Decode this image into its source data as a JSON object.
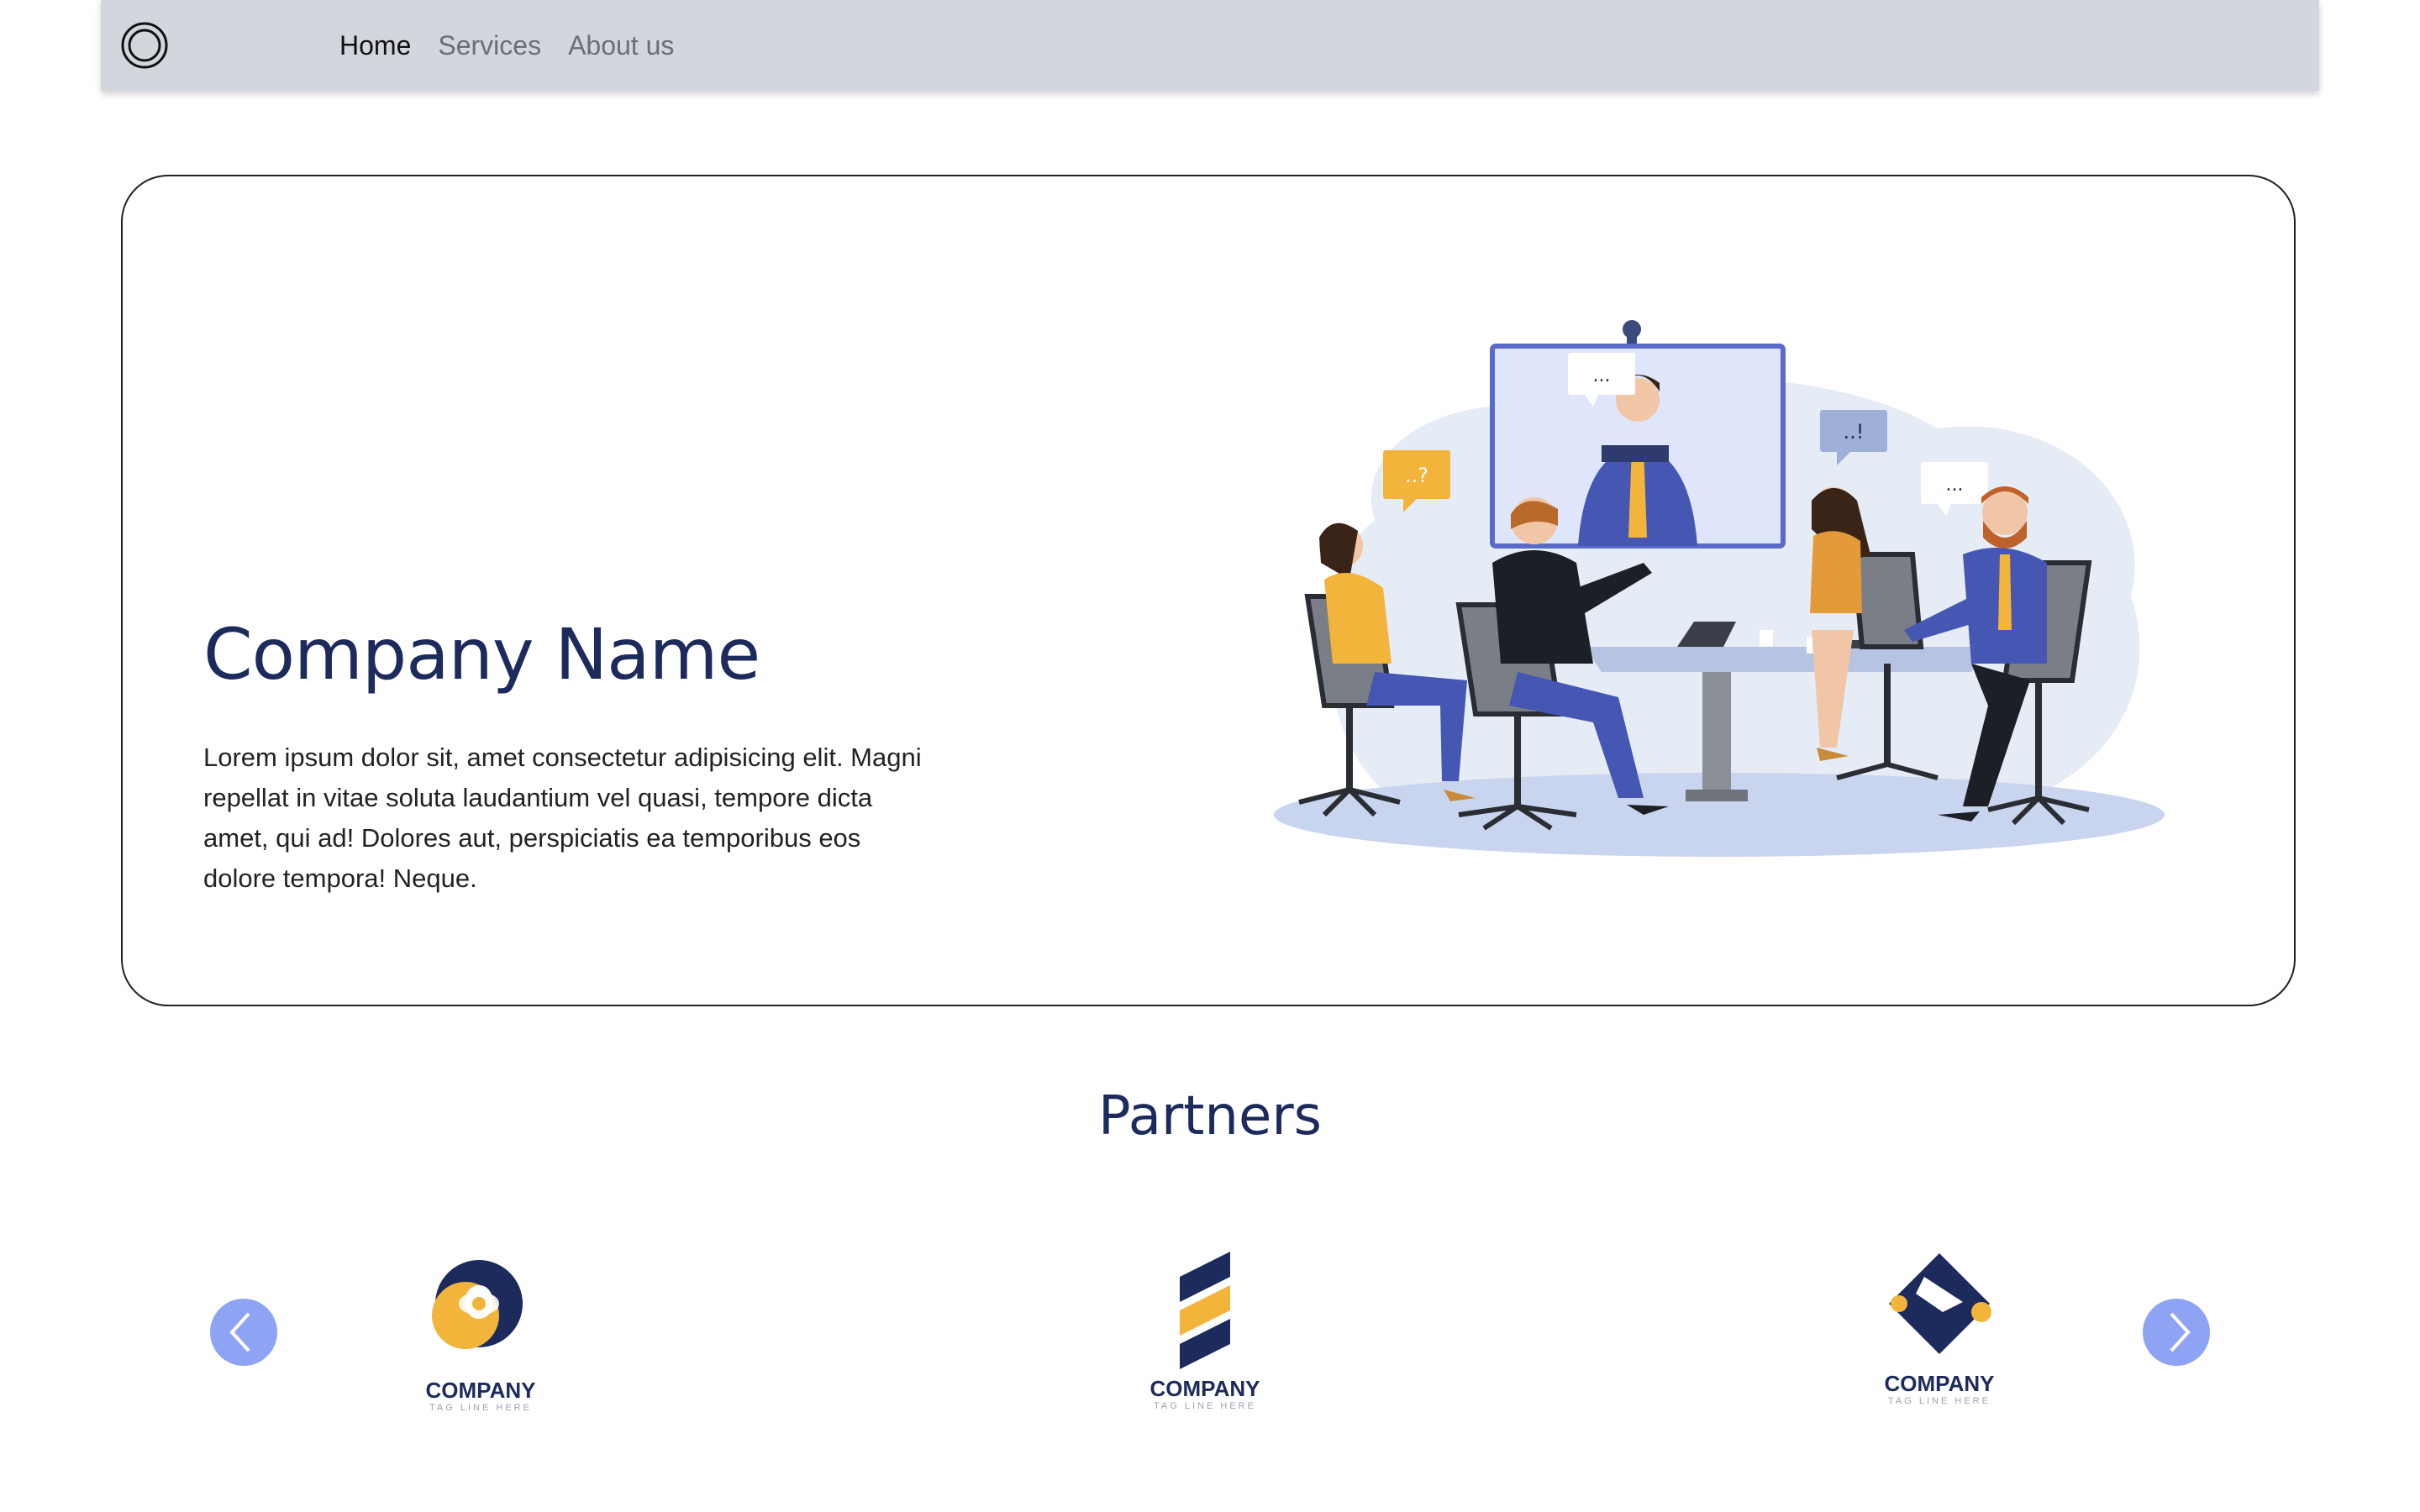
{
  "navbar": {
    "logo_icon": "concentric-circle-logo",
    "links": [
      {
        "label": "Home",
        "active": true
      },
      {
        "label": "Services",
        "active": false
      },
      {
        "label": "About us",
        "active": false
      }
    ]
  },
  "hero": {
    "title": "Company Name",
    "description": "Lorem ipsum dolor sit, amet consectetur adipisicing elit. Magni repellat in vitae soluta laudantium vel quasi, tempore dicta amet, qui ad! Dolores aut, perspiciatis ea temporibus eos dolore tempora! Neque.",
    "illustration": "video-conference-meeting-illustration",
    "bubbles": [
      "...",
      "..?",
      "..!",
      "..."
    ]
  },
  "partners": {
    "title": "Partners",
    "prev_icon": "chevron-left-icon",
    "next_icon": "chevron-right-icon",
    "items": [
      {
        "name": "COMPANY",
        "tagline": "TAG LINE HERE"
      },
      {
        "name": "COMPANY",
        "tagline": "TAG LINE HERE"
      },
      {
        "name": "COMPANY",
        "tagline": "TAG LINE HERE"
      }
    ]
  },
  "colors": {
    "navbar_bg": "#d2d7de",
    "heading": "#1d2a5c",
    "arrow_bg": "#8fa3f5",
    "accent_gold": "#f2b43a",
    "accent_navy": "#1d2a5c"
  }
}
